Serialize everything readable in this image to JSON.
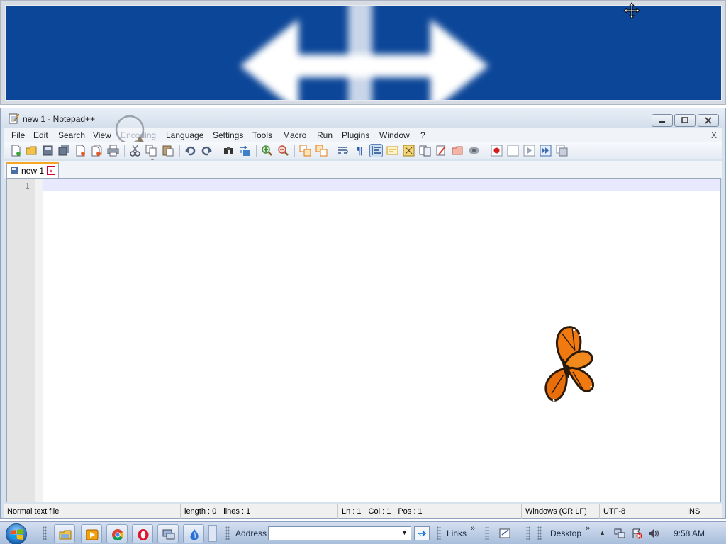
{
  "window": {
    "title": "new 1 - Notepad++",
    "min_label": "—",
    "max_label": "❐",
    "close_label": "✕"
  },
  "menu": {
    "items": [
      "File",
      "Edit",
      "Search",
      "View",
      "Encoding",
      "Language",
      "Settings",
      "Tools",
      "Macro",
      "Run",
      "Plugins",
      "Window",
      "?"
    ],
    "close": "X"
  },
  "toolbar": {
    "icons": [
      "new-file-icon",
      "open-file-icon",
      "save-icon",
      "save-all-icon",
      "close-icon",
      "close-all-icon",
      "print-icon",
      "cut-icon",
      "copy-icon",
      "paste-icon",
      "undo-icon",
      "redo-icon",
      "find-icon",
      "replace-icon",
      "zoom-in-icon",
      "zoom-out-icon",
      "sync-vertical-icon",
      "sync-horizontal-icon",
      "word-wrap-icon",
      "show-all-chars-icon",
      "indent-guide-icon",
      "user-language-icon",
      "doc-map-icon",
      "function-list-icon",
      "folder-as-workspace-icon",
      "monitoring-icon",
      "start-record-icon",
      "stop-record-icon",
      "playback-icon",
      "run-macro-multiple-icon",
      "save-macro-icon"
    ]
  },
  "tab": {
    "label": "new 1",
    "close": "x"
  },
  "editor": {
    "line_numbers": [
      "1"
    ],
    "content": ""
  },
  "status": {
    "file_type": "Normal text file",
    "length": "length : 0",
    "lines": "lines : 1",
    "ln": "Ln : 1",
    "col": "Col : 1",
    "pos": "Pos : 1",
    "eol": "Windows (CR LF)",
    "encoding": "UTF-8",
    "mode": "INS"
  },
  "taskbar": {
    "address_label": "Address",
    "address_value": "",
    "links_label": "Links",
    "desktop_label": "Desktop",
    "clock": "9:58 AM",
    "pinned": [
      "explorer-icon",
      "media-player-icon",
      "chrome-icon",
      "opera-icon",
      "remote-desktop-icon",
      "app-icon"
    ]
  },
  "colors": {
    "magnifier_bg": "#0c4698",
    "current_line": "#e8e8ff",
    "tab_accent": "#f5a623",
    "butterfly": "#f07a10"
  }
}
